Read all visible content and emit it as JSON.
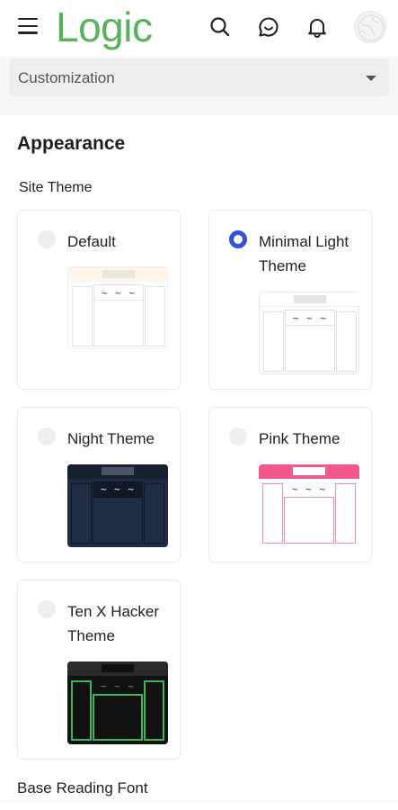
{
  "header": {
    "logo_text": "Logic",
    "logo_color": "#57b35a",
    "icons": [
      "menu-icon",
      "search-icon",
      "chat-icon",
      "bell-icon",
      "avatar"
    ]
  },
  "dropdown": {
    "selected": "Customization"
  },
  "appearance": {
    "title": "Appearance",
    "site_theme_label": "Site Theme",
    "themes": [
      {
        "label": "Default",
        "selected": false,
        "accent": "#fbf6e9"
      },
      {
        "label": "Minimal Light Theme",
        "selected": true,
        "accent": "#ffffff"
      },
      {
        "label": "Night Theme",
        "selected": false,
        "accent": "#1f2d44"
      },
      {
        "label": "Pink Theme",
        "selected": false,
        "accent": "#f4578d"
      },
      {
        "label": "Ten X Hacker Theme",
        "selected": false,
        "accent": "#3fb65d"
      }
    ],
    "preview_squiggle": "~ ~ ~",
    "selected_radio_color": "#3550d8"
  },
  "base_reading_font_label": "Base Reading Font"
}
